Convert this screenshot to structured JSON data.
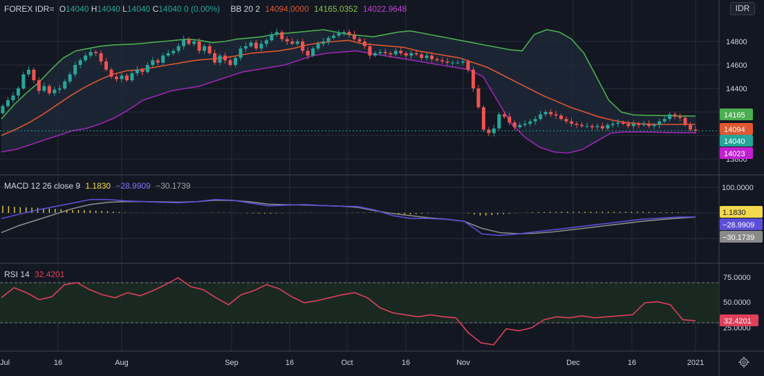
{
  "symbol_button": "IDR",
  "price_header": {
    "name": "FOREX IDR=",
    "o_label": "O",
    "o_value": "14040",
    "h_label": "H",
    "h_value": "14040",
    "l_label": "L",
    "l_value": "14040",
    "c_label": "C",
    "c_value": "14040",
    "change": "0 (0.00%)",
    "bb_label": "BB 20 2",
    "bb_basis": "14094.0000",
    "bb_upper": "14165.0352",
    "bb_lower": "14022.9648"
  },
  "macd_header": {
    "label": "MACD 12 26 close 9",
    "hist": "1.1830",
    "macd": "−28.9909",
    "signal": "−30.1739"
  },
  "rsi_header": {
    "label": "RSI 14",
    "value": "32.4201"
  },
  "price_axis_ticks": [
    "14800",
    "14600",
    "14400",
    "13800"
  ],
  "price_badges": [
    "14165",
    "14094",
    "14040",
    "14023"
  ],
  "macd_axis_ticks": [
    "100.0000"
  ],
  "macd_badges": [
    "1.1830",
    "−28.9909",
    "−30.1739"
  ],
  "rsi_axis_ticks": [
    "75.0000",
    "50.0000",
    "25.0000"
  ],
  "rsi_badges": [
    "32.4201"
  ],
  "time_ticks": [
    "Jul",
    "16",
    "Aug",
    "Sep",
    "16",
    "Oct",
    "16",
    "Nov",
    "Dec",
    "16",
    "2021"
  ],
  "colors": {
    "bg": "#131722",
    "up": "#26a69a",
    "down": "#ef5350",
    "bb_upper": "#4caf50",
    "bb_basis": "#e0572f",
    "bb_lower": "#9c27b0",
    "macd": "#5b4fd6",
    "signal": "#8a8a8a",
    "hist": "#e8d23c",
    "rsi": "#e0405a"
  },
  "chart_data": [
    {
      "type": "candlestick",
      "title": "FOREX IDR=",
      "indicator": "Bollinger Bands 20 2",
      "ylim": [
        13800,
        14960
      ],
      "x_ticks": [
        "Jul",
        "16",
        "Aug",
        "Sep",
        "16",
        "Oct",
        "16",
        "Nov",
        "Dec",
        "16",
        "2021"
      ],
      "close": [
        14250,
        14300,
        14340,
        14400,
        14520,
        14560,
        14470,
        14380,
        14420,
        14360,
        14390,
        14400,
        14460,
        14520,
        14600,
        14640,
        14680,
        14710,
        14700,
        14630,
        14560,
        14500,
        14480,
        14510,
        14470,
        14530,
        14560,
        14540,
        14600,
        14640,
        14620,
        14680,
        14700,
        14720,
        14760,
        14820,
        14780,
        14800,
        14720,
        14760,
        14700,
        14620,
        14680,
        14640,
        14600,
        14660,
        14740,
        14760,
        14790,
        14740,
        14780,
        14810,
        14860,
        14880,
        14820,
        14800,
        14780,
        14800,
        14720,
        14680,
        14740,
        14780,
        14800,
        14830,
        14850,
        14870,
        14880,
        14860,
        14820,
        14800,
        14760,
        14680,
        14700,
        14710,
        14700,
        14690,
        14720,
        14700,
        14680,
        14700,
        14690,
        14660,
        14680,
        14650,
        14640,
        14630,
        14620,
        14620,
        14620,
        14630,
        14560,
        14400,
        14240,
        14050,
        14020,
        14060,
        14180,
        14160,
        14110,
        14070,
        14090,
        14100,
        14120,
        14140,
        14180,
        14200,
        14180,
        14170,
        14140,
        14120,
        14100,
        14090,
        14080,
        14080,
        14070,
        14080,
        14060,
        14090,
        14100,
        14110,
        14100,
        14080,
        14100,
        14090,
        14100,
        14080,
        14090,
        14120,
        14140,
        14180,
        14160,
        14150,
        14090,
        14050,
        14040
      ],
      "bb_upper": [
        14140,
        14260,
        14360,
        14450,
        14560,
        14660,
        14720,
        14740,
        14760,
        14770,
        14775,
        14780,
        14790,
        14800,
        14810,
        14820,
        14810,
        14790,
        14800,
        14820,
        14830,
        14840,
        14860,
        14870,
        14880,
        14890,
        14900,
        14880,
        14860,
        14850,
        14840,
        14860,
        14880,
        14890,
        14870,
        14850,
        14830,
        14810,
        14790,
        14770,
        14750,
        14730,
        14720,
        14860,
        14900,
        14880,
        14820,
        14700,
        14500,
        14300,
        14200,
        14175,
        14172,
        14170,
        14168,
        14166,
        14165
      ],
      "bb_basis": [
        14000,
        14050,
        14110,
        14180,
        14260,
        14340,
        14410,
        14470,
        14520,
        14550,
        14560,
        14580,
        14600,
        14620,
        14640,
        14650,
        14660,
        14680,
        14700,
        14710,
        14720,
        14740,
        14770,
        14790,
        14800,
        14810,
        14780,
        14770,
        14760,
        14750,
        14720,
        14700,
        14680,
        14660,
        14620,
        14580,
        14520,
        14460,
        14400,
        14340,
        14290,
        14240,
        14200,
        14160,
        14130,
        14110,
        14100,
        14095,
        14094,
        14094,
        14094
      ],
      "bb_lower": [
        13860,
        13880,
        13920,
        13960,
        14000,
        14040,
        14060,
        14100,
        14150,
        14220,
        14300,
        14340,
        14380,
        14400,
        14420,
        14460,
        14500,
        14540,
        14560,
        14580,
        14600,
        14640,
        14680,
        14700,
        14710,
        14720,
        14700,
        14680,
        14660,
        14640,
        14620,
        14600,
        14580,
        14560,
        14500,
        14300,
        14100,
        13980,
        13900,
        13860,
        13850,
        13880,
        13950,
        14020,
        14030,
        14030,
        14028,
        14025,
        14023,
        14023
      ]
    },
    {
      "type": "line",
      "title": "MACD 12 26 close 9",
      "series": [
        {
          "name": "MACD",
          "values": [
            -40,
            -10,
            20,
            45,
            70,
            95,
            95,
            85,
            80,
            75,
            72,
            80,
            95,
            90,
            70,
            50,
            55,
            60,
            52,
            48,
            45,
            20,
            -20,
            -40,
            -40,
            -45,
            -60,
            -150,
            -160,
            -150,
            -135,
            -120,
            -105,
            -90,
            -75,
            -60,
            -45,
            -38,
            -30,
            -29
          ]
        },
        {
          "name": "Signal",
          "values": [
            -140,
            -90,
            -50,
            -10,
            30,
            60,
            75,
            80,
            80,
            78,
            76,
            80,
            90,
            88,
            78,
            62,
            58,
            56,
            52,
            48,
            40,
            15,
            -5,
            -20,
            -35,
            -45,
            -60,
            -110,
            -140,
            -148,
            -145,
            -135,
            -120,
            -105,
            -90,
            -75,
            -60,
            -48,
            -38,
            -30
          ]
        },
        {
          "name": "Histogram",
          "values": [
            100,
            80,
            70,
            55,
            40,
            35,
            20,
            5,
            0,
            -3,
            -4,
            0,
            5,
            2,
            -8,
            -12,
            -3,
            4,
            0,
            0,
            5,
            5,
            -15,
            -20,
            -5,
            0,
            0,
            -40,
            -20,
            -2,
            10,
            15,
            15,
            15,
            15,
            15,
            15,
            10,
            8,
            1
          ]
        }
      ],
      "ylim": [
        -170,
        110
      ]
    },
    {
      "type": "line",
      "title": "RSI 14",
      "levels": [
        70,
        30
      ],
      "ylim": [
        0,
        100
      ],
      "series": [
        {
          "name": "RSI",
          "values": [
            55,
            65,
            60,
            53,
            56,
            68,
            70,
            63,
            58,
            55,
            60,
            57,
            62,
            68,
            75,
            66,
            63,
            55,
            48,
            58,
            62,
            68,
            64,
            56,
            50,
            52,
            55,
            58,
            60,
            55,
            45,
            40,
            38,
            36,
            38,
            36,
            35,
            20,
            10,
            8,
            24,
            22,
            25,
            33,
            36,
            35,
            37,
            35,
            36,
            37,
            38,
            50,
            51,
            48,
            33,
            32
          ]
        }
      ]
    }
  ]
}
